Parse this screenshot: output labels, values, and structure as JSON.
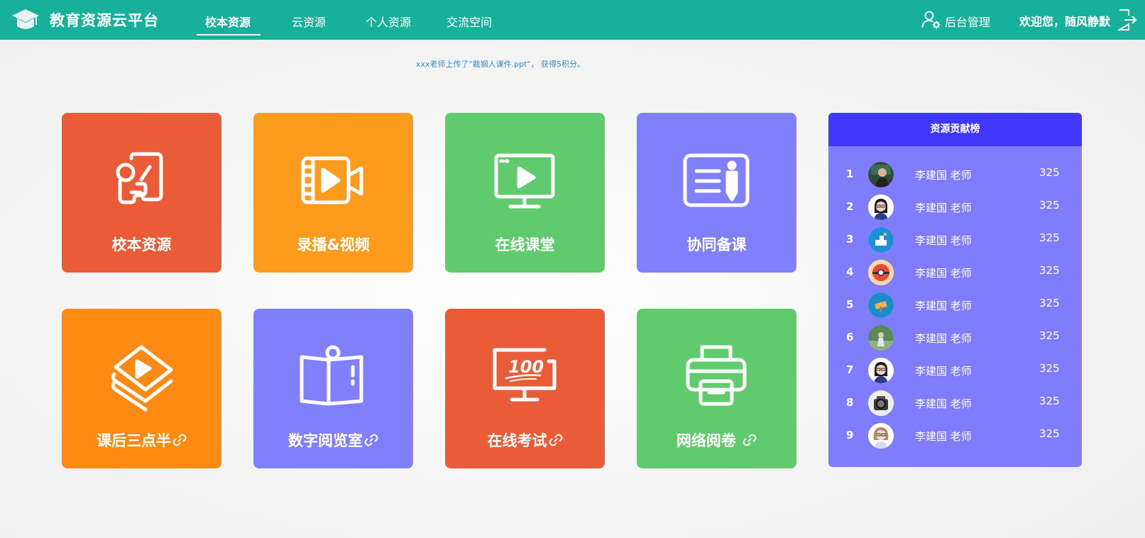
{
  "header": {
    "title": "教育资源云平台",
    "nav": [
      {
        "label": "校本资源",
        "active": true
      },
      {
        "label": "云资源",
        "active": false
      },
      {
        "label": "个人资源",
        "active": false
      },
      {
        "label": "交流空间",
        "active": false
      }
    ],
    "admin_label": "后台管理",
    "welcome": "欢迎您，随风静默"
  },
  "notice": "xxx老师上传了\"裁钢人课件.ppt\"， 获得5积分。",
  "tiles": [
    {
      "label": "校本资源",
      "color": "#ea5c38",
      "icon": "puzzle-icon",
      "linked": false
    },
    {
      "label": "录播&视频",
      "color": "#fd9b1d",
      "icon": "video-camera-icon",
      "linked": false
    },
    {
      "label": "在线课堂",
      "color": "#60cb6c",
      "icon": "monitor-play-icon",
      "linked": false
    },
    {
      "label": "协同备课",
      "color": "#8080fd",
      "icon": "notes-pen-icon",
      "linked": false
    },
    {
      "label": "课后三点半",
      "color": "#fd8a13",
      "icon": "stacked-video-icon",
      "linked": true
    },
    {
      "label": "数字阅览室",
      "color": "#8080fd",
      "icon": "open-book-icon",
      "linked": true
    },
    {
      "label": "在线考试",
      "color": "#ea5c38",
      "icon": "monitor-100-icon",
      "linked": true
    },
    {
      "label": "网络阅卷",
      "color": "#60cb6c",
      "icon": "printer-icon",
      "linked": true
    }
  ],
  "ranking": {
    "title": "资源贡献榜",
    "rows": [
      {
        "rank": "1",
        "name": "李建国 老师",
        "score": "325"
      },
      {
        "rank": "2",
        "name": "李建国 老师",
        "score": "325"
      },
      {
        "rank": "3",
        "name": "李建国 老师",
        "score": "325"
      },
      {
        "rank": "4",
        "name": "李建国 老师",
        "score": "325"
      },
      {
        "rank": "5",
        "name": "李建国 老师",
        "score": "325"
      },
      {
        "rank": "6",
        "name": "李建国 老师",
        "score": "325"
      },
      {
        "rank": "7",
        "name": "李建国 老师",
        "score": "325"
      },
      {
        "rank": "8",
        "name": "李建国 老师",
        "score": "325"
      },
      {
        "rank": "9",
        "name": "李建国 老师",
        "score": "325"
      }
    ]
  },
  "colors": {
    "header": "#17b09b",
    "ranking_header": "#3f38fb",
    "ranking_body": "#7f7dfd",
    "notice_text": "#2f8fd0"
  }
}
